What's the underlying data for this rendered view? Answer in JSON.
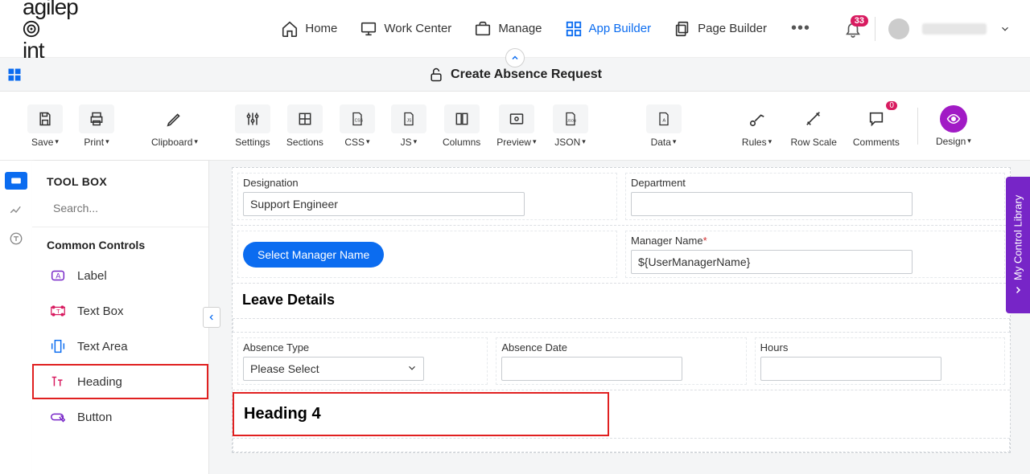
{
  "brand": "agilepoint",
  "nav": {
    "home": "Home",
    "workcenter": "Work Center",
    "manage": "Manage",
    "appbuilder": "App Builder",
    "pagebuilder": "Page Builder",
    "notif_count": "33"
  },
  "subheader": {
    "title": "Create Absence Request"
  },
  "toolbar": {
    "save": "Save",
    "print": "Print",
    "clipboard": "Clipboard",
    "settings": "Settings",
    "sections": "Sections",
    "css": "CSS",
    "js": "JS",
    "columns": "Columns",
    "preview": "Preview",
    "json": "JSON",
    "data": "Data",
    "rules": "Rules",
    "rowscale": "Row Scale",
    "comments": "Comments",
    "comments_count": "0",
    "design": "Design"
  },
  "toolbox": {
    "title": "TOOL BOX",
    "search_placeholder": "Search...",
    "group_common": "Common Controls",
    "items": {
      "label": "Label",
      "textbox": "Text Box",
      "textarea": "Text Area",
      "heading": "Heading",
      "button": "Button"
    }
  },
  "form": {
    "designation_label": "Designation",
    "designation_value": "Support Engineer",
    "department_label": "Department",
    "department_value": "",
    "select_manager_btn": "Select Manager Name",
    "manager_label": "Manager Name",
    "manager_value": "${UserManagerName}",
    "leave_section": "Leave Details",
    "absence_type_label": "Absence Type",
    "absence_type_value": "Please Select",
    "absence_date_label": "Absence Date",
    "absence_date_value": "",
    "hours_label": "Hours",
    "hours_value": "",
    "heading4": "Heading 4"
  },
  "sidetab": "My Control Library"
}
